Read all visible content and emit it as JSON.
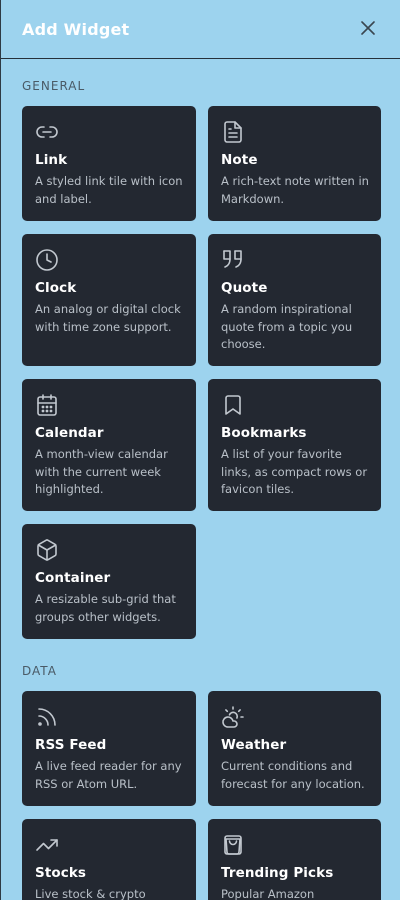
{
  "header": {
    "title": "Add Widget"
  },
  "sections": [
    {
      "label": "GENERAL",
      "widgets": [
        {
          "title": "Link",
          "description": "A styled link tile with icon and label.",
          "icon": "link-icon"
        },
        {
          "title": "Note",
          "description": "A rich-text note written in Markdown.",
          "icon": "note-icon"
        },
        {
          "title": "Clock",
          "description": "An analog or digital clock with time zone support.",
          "icon": "clock-icon"
        },
        {
          "title": "Quote",
          "description": "A random inspirational quote from a topic you choose.",
          "icon": "quote-icon"
        },
        {
          "title": "Calendar",
          "description": "A month-view calendar with the current week highlighted.",
          "icon": "calendar-icon"
        },
        {
          "title": "Bookmarks",
          "description": "A list of your favorite links, as compact rows or favicon tiles.",
          "icon": "bookmark-icon"
        },
        {
          "title": "Container",
          "description": "A resizable sub-grid that groups other widgets.",
          "icon": "box-icon"
        }
      ]
    },
    {
      "label": "DATA",
      "widgets": [
        {
          "title": "RSS Feed",
          "description": "A live feed reader for any RSS or Atom URL.",
          "icon": "rss-icon"
        },
        {
          "title": "Weather",
          "description": "Current conditions and forecast for any location.",
          "icon": "weather-icon"
        },
        {
          "title": "Stocks",
          "description": "Live stock & crypto",
          "icon": "trending-up-icon"
        },
        {
          "title": "Trending Picks",
          "description": "Popular Amazon",
          "icon": "shopping-bag-icon"
        }
      ]
    }
  ]
}
